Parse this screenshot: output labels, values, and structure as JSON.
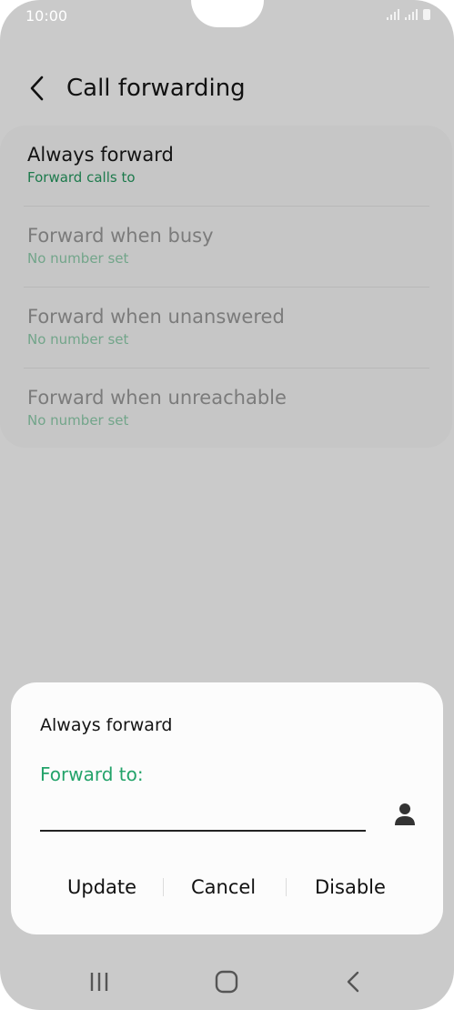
{
  "status_bar": {
    "time": "10:00"
  },
  "header": {
    "title": "Call forwarding"
  },
  "options": [
    {
      "title": "Always forward",
      "subtitle": "Forward calls to"
    },
    {
      "title": "Forward when busy",
      "subtitle": "No number set"
    },
    {
      "title": "Forward when unanswered",
      "subtitle": "No number set"
    },
    {
      "title": "Forward when unreachable",
      "subtitle": "No number set"
    }
  ],
  "dialog": {
    "title": "Always forward",
    "field_label": "Forward to:",
    "field_value": "",
    "buttons": {
      "update": "Update",
      "cancel": "Cancel",
      "disable": "Disable"
    }
  },
  "colors": {
    "accent_green": "#23a36a",
    "subtitle_green": "#1d7a4c",
    "scrim": "#cacaca"
  },
  "icons": [
    "back-arrow-icon",
    "signal-icon",
    "battery-icon",
    "contact-icon",
    "recents-icon",
    "home-icon",
    "nav-back-icon"
  ]
}
